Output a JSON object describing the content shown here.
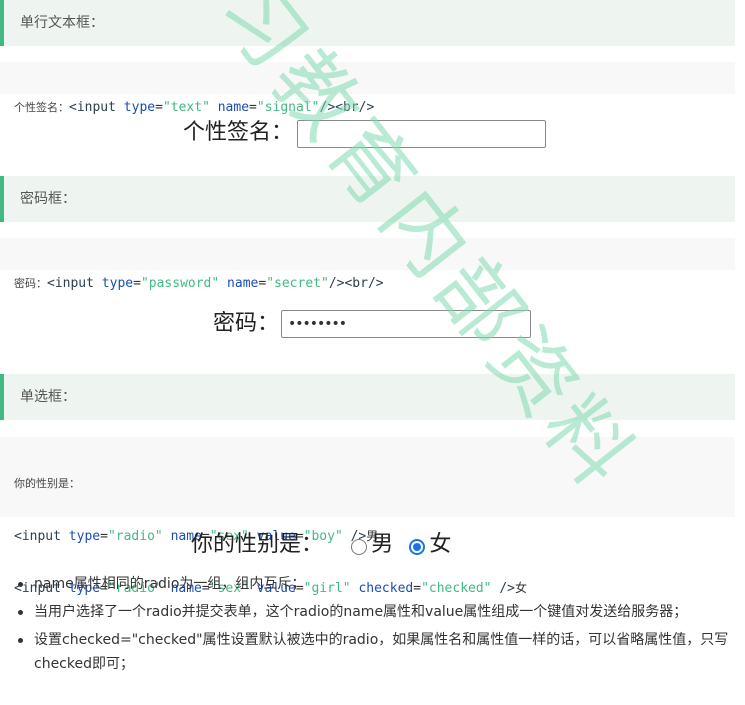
{
  "sections": {
    "text_box": {
      "heading": "单行文本框：",
      "code_label": "个性签名：",
      "code": {
        "tag_open": "<input",
        "attr1": "type",
        "val1": "\"text\"",
        "attr2": "name",
        "val2": "\"signal\"",
        "tail": "/><br/>"
      },
      "demo_label": "个性签名：",
      "demo_value": ""
    },
    "password_box": {
      "heading": "密码框：",
      "code_label": "密码：",
      "code": {
        "tag_open": "<input",
        "attr1": "type",
        "val1": "\"password\"",
        "attr2": "name",
        "val2": "\"secret\"",
        "tail": "/><br/>"
      },
      "demo_label": "密码：",
      "demo_value": "••••••••"
    },
    "radio": {
      "heading": "单选框：",
      "code_comment": "你的性别是：",
      "code_lines": [
        {
          "tag_open": "<input",
          "a1": "type",
          "v1": "\"radio\"",
          "a2": "name",
          "v2": "\"sex\"",
          "a3": "value",
          "v3": "\"boy\"",
          "tail": " />",
          "text": "男"
        },
        {
          "tag_open": "<input",
          "a1": "type",
          "v1": "\"radio\"",
          "a2": "name",
          "v2": "\"sex\"",
          "a3": "value",
          "v3": "\"girl\"",
          "a4": "checked",
          "v4": "\"checked\"",
          "tail": " />",
          "text": "女"
        }
      ],
      "demo_label": "你的性别是：",
      "options": [
        {
          "label": "男",
          "checked": false
        },
        {
          "label": "女",
          "checked": true
        }
      ]
    }
  },
  "notes": [
    "name属性相同的radio为一组，组内互斥；",
    "当用户选择了一个radio并提交表单，这个radio的name属性和value属性组成一个键值对发送给服务器；",
    "设置checked=\"checked\"属性设置默认被选中的radio，如果属性名和属性值一样的话，可以省略属性值，只写checked即可；"
  ],
  "watermark": {
    "text": "习教育内部资料",
    "color": "#7fd9b0"
  }
}
